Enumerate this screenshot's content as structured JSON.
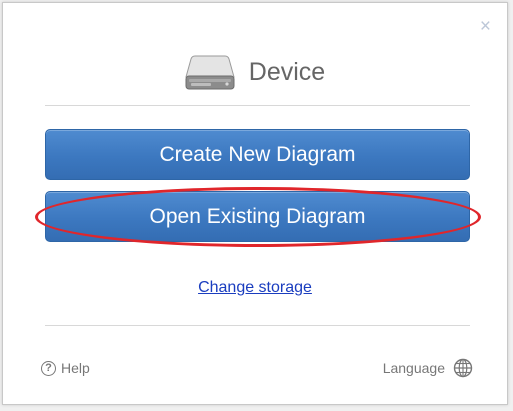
{
  "dialog": {
    "close_symbol": "×",
    "title": "Device",
    "title_icon": "hard-drive-icon",
    "buttons": {
      "create_label": "Create New Diagram",
      "open_label": "Open Existing Diagram"
    },
    "change_storage_label": "Change storage",
    "footer": {
      "help_symbol": "?",
      "help_label": "Help",
      "language_label": "Language",
      "language_icon": "globe-icon"
    }
  },
  "colors": {
    "button": "#3c78c0",
    "highlight": "#e0262b",
    "link": "#1a3dbf"
  }
}
